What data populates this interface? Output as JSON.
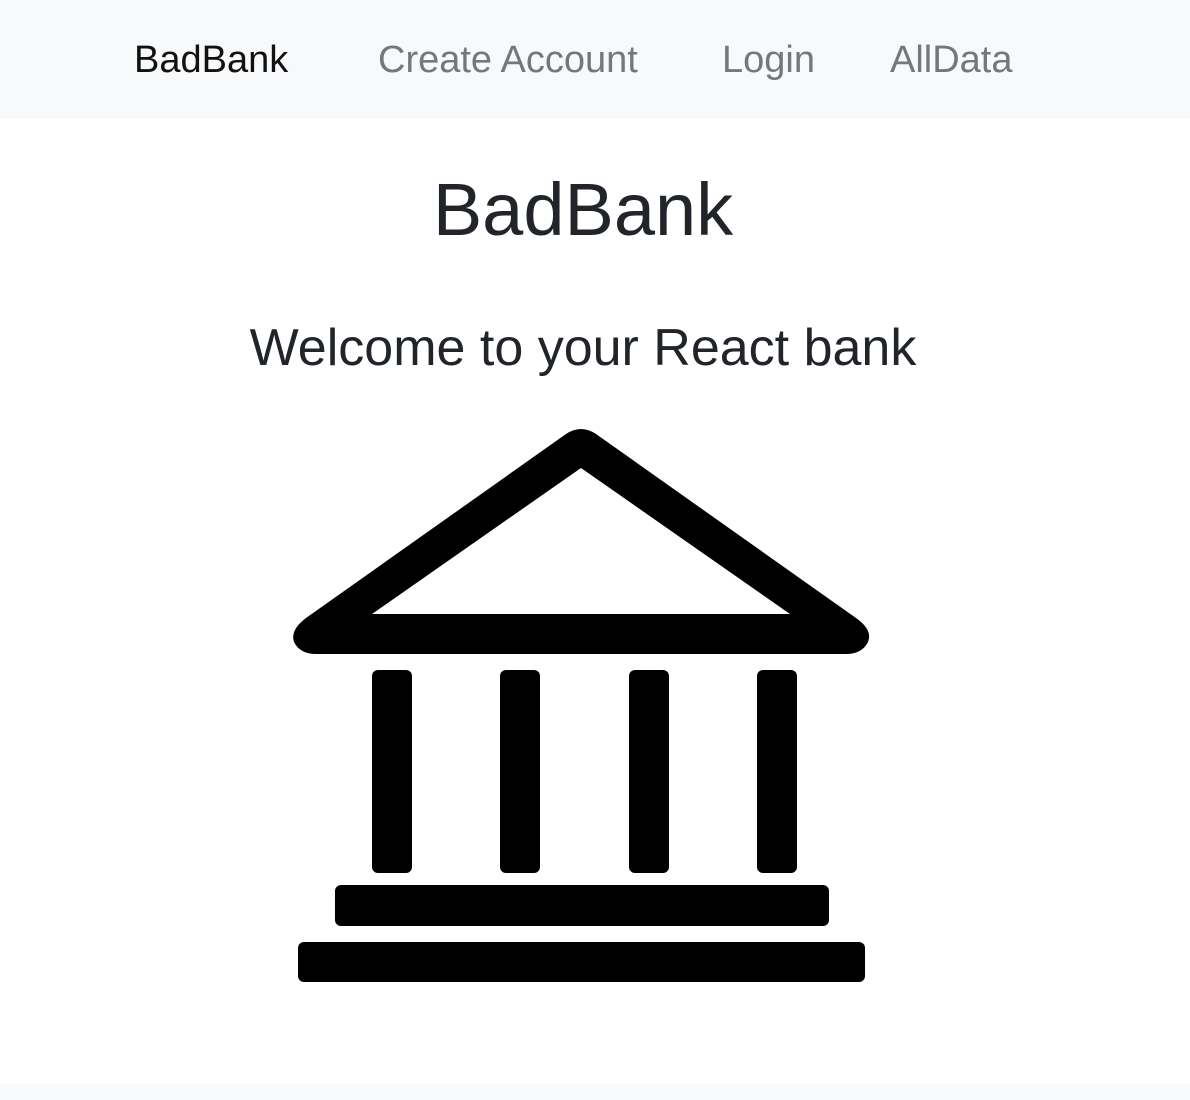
{
  "navbar": {
    "brand": "BadBank",
    "links": [
      {
        "label": "Create Account"
      },
      {
        "label": "Login"
      },
      {
        "label": "AllData"
      }
    ]
  },
  "main": {
    "title": "BadBank",
    "subtitle": "Welcome to your React bank",
    "image": {
      "icon": "bank-building-icon",
      "color": "#000000"
    }
  },
  "theme": {
    "navbar_background": "#f8f9fa",
    "text_color": "#212529",
    "link_color": "#74787c"
  }
}
